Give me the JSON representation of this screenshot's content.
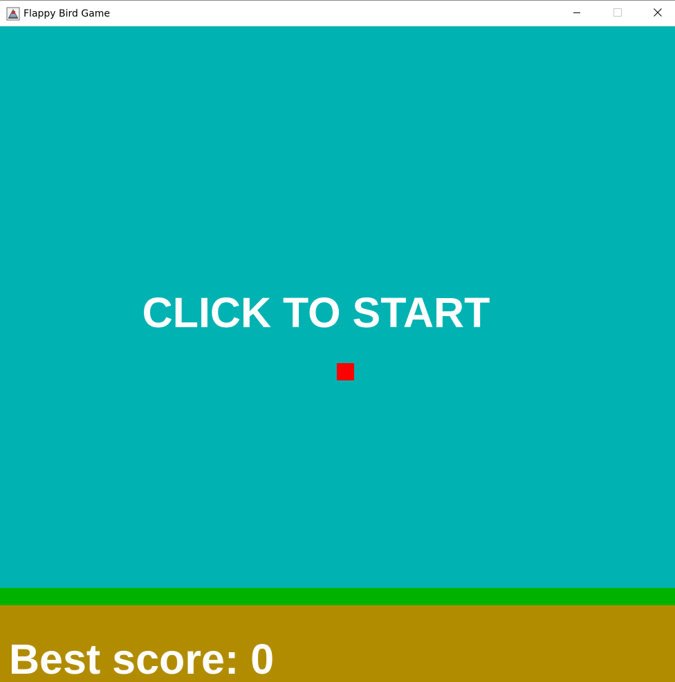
{
  "window": {
    "title": "Flappy Bird Game",
    "icon": "java-cup-icon",
    "controls": {
      "minimize_icon": "minimize-icon",
      "maximize_icon": "maximize-icon",
      "close_icon": "close-icon"
    }
  },
  "game": {
    "start_prompt": "CLICK TO START",
    "best_score_label": "Best score: 0",
    "best_score": 0
  },
  "colors": {
    "sky": "#00b2b2",
    "grass": "#00b200",
    "ground": "#b28c00",
    "bird": "#ff0000",
    "text": "#ffffff"
  }
}
